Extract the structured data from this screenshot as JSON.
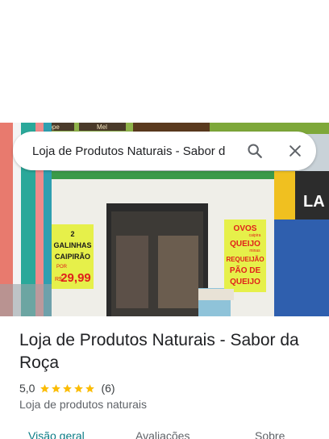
{
  "search": {
    "query": "Loja de Produtos Naturais - Sabor d"
  },
  "photo": {
    "top_signs": [
      "Xarope",
      "Mel"
    ],
    "left_sign_lines": [
      "2",
      "GALINHAS",
      "CAIPIRÃO"
    ],
    "left_sign_price_prefix": "POR",
    "left_sign_price": "29,99",
    "left_sign_currency": "R$",
    "right_sign_lines": [
      "OVOS",
      "caipira",
      "QUEIJO",
      "minas",
      "REQUEIJÃO",
      "PÃO DE",
      "QUEIJO"
    ],
    "right_store_sign": "LA"
  },
  "place": {
    "title": "Loja de Produtos Naturais - Sabor da Roça",
    "rating": "5,0",
    "stars": 5,
    "review_count": "(6)",
    "category": "Loja de produtos naturais"
  },
  "tabs": [
    {
      "label": "Visão geral",
      "active": true
    },
    {
      "label": "Avaliações",
      "active": false
    },
    {
      "label": "Sobre",
      "active": false
    }
  ],
  "colors": {
    "accent": "#0b7c86",
    "star": "#fbbc04",
    "sign_yellow": "#e6f04a",
    "sign_red": "#e0211b"
  }
}
